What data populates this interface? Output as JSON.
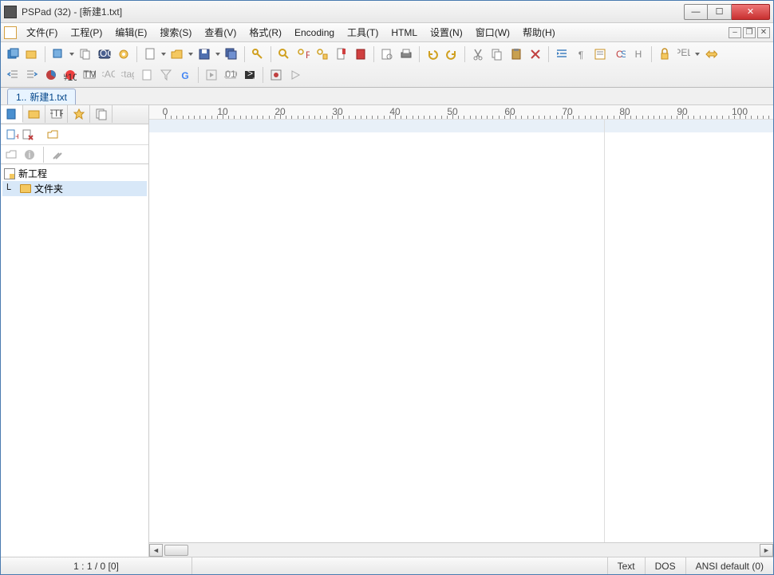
{
  "title": "PSPad (32) - [新建1.txt]",
  "menu": [
    "文件(F)",
    "工程(P)",
    "编辑(E)",
    "搜索(S)",
    "查看(V)",
    "格式(R)",
    "Encoding",
    "工具(T)",
    "HTML",
    "设置(N)",
    "窗口(W)",
    "帮助(H)"
  ],
  "filetab": {
    "num": "1..",
    "name": "新建1.txt"
  },
  "ruler": {
    "start": 0,
    "end": 100,
    "step": 10,
    "labels": [
      "0",
      "10",
      "20",
      "30",
      "40",
      "50",
      "60",
      "70",
      "80",
      "90",
      "100"
    ]
  },
  "project": {
    "root": "新工程",
    "folder": "文件夹"
  },
  "status": {
    "pos": "1 : 1 / 0  [0]",
    "mode": "Text",
    "eol": "DOS",
    "enc": "ANSI default (0)"
  },
  "side_icons": [
    "new-file",
    "add-folder",
    "open-folder"
  ],
  "side_icons2": [
    "paste",
    "info",
    "sep",
    "tools"
  ]
}
